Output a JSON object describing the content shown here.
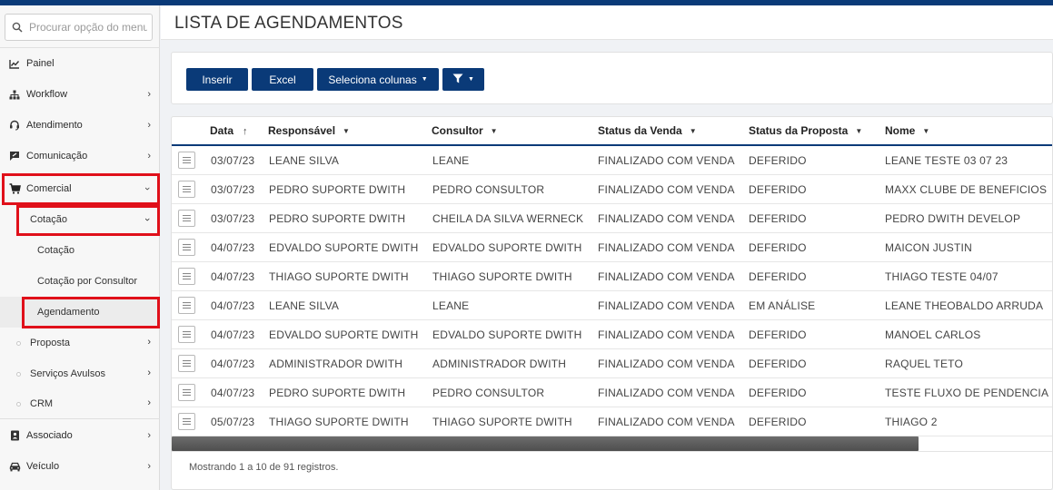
{
  "search": {
    "placeholder": "Procurar opção do menu"
  },
  "sidebar": {
    "items": [
      {
        "label": "Painel"
      },
      {
        "label": "Workflow"
      },
      {
        "label": "Atendimento"
      },
      {
        "label": "Comunicação"
      },
      {
        "label": "Comercial"
      },
      {
        "label": "Associado"
      },
      {
        "label": "Veículo"
      }
    ],
    "comercial_sub": [
      {
        "label": "Cotação"
      },
      {
        "label": "Proposta"
      },
      {
        "label": "Serviços Avulsos"
      },
      {
        "label": "CRM"
      }
    ],
    "cotacao_sub": [
      {
        "label": "Cotação"
      },
      {
        "label": "Cotação por Consultor"
      },
      {
        "label": "Agendamento"
      }
    ],
    "chevron": "›"
  },
  "page": {
    "title": "LISTA DE AGENDAMENTOS"
  },
  "toolbar": {
    "insert_label": "Inserir",
    "excel_label": "Excel",
    "columns_label": "Seleciona colunas"
  },
  "table": {
    "columns": [
      "Data",
      "Responsável",
      "Consultor",
      "Status da Venda",
      "Status da Proposta",
      "Nome"
    ],
    "rows": [
      [
        "03/07/23",
        "LEANE SILVA",
        "LEANE",
        "FINALIZADO COM VENDA",
        "DEFERIDO",
        "LEANE TESTE 03 07 23"
      ],
      [
        "03/07/23",
        "PEDRO SUPORTE DWITH",
        "PEDRO CONSULTOR",
        "FINALIZADO COM VENDA",
        "DEFERIDO",
        "MAXX CLUBE DE BENEFICIOS"
      ],
      [
        "03/07/23",
        "PEDRO SUPORTE DWITH",
        "CHEILA DA SILVA WERNECK",
        "FINALIZADO COM VENDA",
        "DEFERIDO",
        "PEDRO DWITH DEVELOP"
      ],
      [
        "04/07/23",
        "EDVALDO SUPORTE DWITH",
        "EDVALDO SUPORTE DWITH",
        "FINALIZADO COM VENDA",
        "DEFERIDO",
        "MAICON JUSTIN"
      ],
      [
        "04/07/23",
        "THIAGO SUPORTE DWITH",
        "THIAGO SUPORTE DWITH",
        "FINALIZADO COM VENDA",
        "DEFERIDO",
        "THIAGO TESTE 04/07"
      ],
      [
        "04/07/23",
        "LEANE SILVA",
        "LEANE",
        "FINALIZADO COM VENDA",
        "EM ANÁLISE",
        "LEANE THEOBALDO ARRUDA"
      ],
      [
        "04/07/23",
        "EDVALDO SUPORTE DWITH",
        "EDVALDO SUPORTE DWITH",
        "FINALIZADO COM VENDA",
        "DEFERIDO",
        "MANOEL CARLOS"
      ],
      [
        "04/07/23",
        "ADMINISTRADOR DWITH",
        "ADMINISTRADOR DWITH",
        "FINALIZADO COM VENDA",
        "DEFERIDO",
        "RAQUEL TETO"
      ],
      [
        "04/07/23",
        "PEDRO SUPORTE DWITH",
        "PEDRO CONSULTOR",
        "FINALIZADO COM VENDA",
        "DEFERIDO",
        "TESTE FLUXO DE PENDENCIA"
      ],
      [
        "05/07/23",
        "THIAGO SUPORTE DWITH",
        "THIAGO SUPORTE DWITH",
        "FINALIZADO COM VENDA",
        "DEFERIDO",
        "THIAGO 2"
      ]
    ],
    "footer": "Mostrando 1 a 10 de 91 registros."
  },
  "colors": {
    "primary": "#0a3a78",
    "highlight": "#e0101a"
  }
}
